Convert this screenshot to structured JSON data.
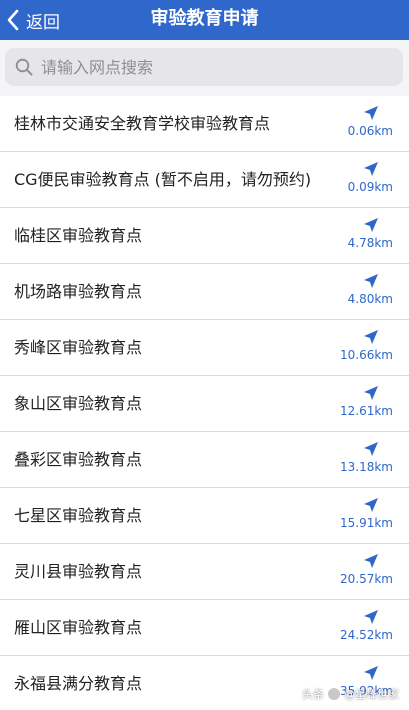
{
  "navbar": {
    "back_label": "返回",
    "title": "审验教育申请",
    "background": "#2f67cb"
  },
  "search": {
    "placeholder": "请输入网点搜索",
    "value": ""
  },
  "locations": [
    {
      "name": "桂林市交通安全教育学校审验教育点",
      "distance": "0.06km"
    },
    {
      "name": "CG便民审验教育点 (暂不启用，请勿预约)",
      "distance": "0.09km"
    },
    {
      "name": "临桂区审验教育点",
      "distance": "4.78km"
    },
    {
      "name": "机场路审验教育点",
      "distance": "4.80km"
    },
    {
      "name": "秀峰区审验教育点",
      "distance": "10.66km"
    },
    {
      "name": "象山区审验教育点",
      "distance": "12.61km"
    },
    {
      "name": "叠彩区审验教育点",
      "distance": "13.18km"
    },
    {
      "name": "七星区审验教育点",
      "distance": "15.91km"
    },
    {
      "name": "灵川县审验教育点",
      "distance": "20.57km"
    },
    {
      "name": "雁山区审验教育点",
      "distance": "24.52km"
    },
    {
      "name": "永福县满分教育点",
      "distance": "35.92km"
    }
  ],
  "watermark": {
    "prefix": "头条",
    "handle": "@星峰世家"
  },
  "icons": {
    "back": "chevron-left-icon",
    "search": "search-icon",
    "navigate": "navigation-arrow-icon"
  },
  "accent_color": "#2f67cb"
}
